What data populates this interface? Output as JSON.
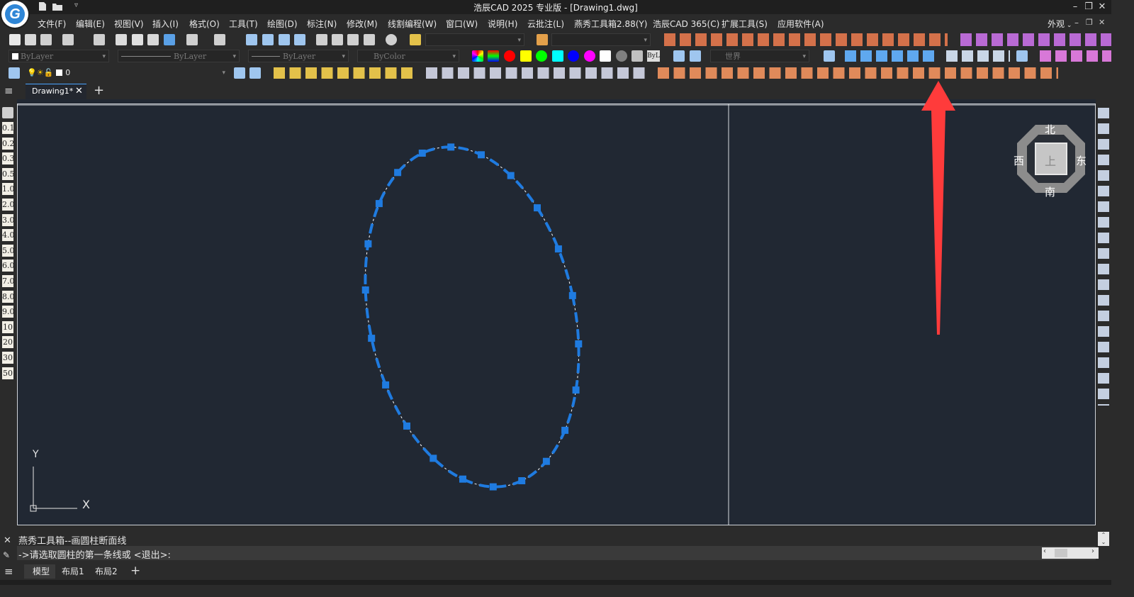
{
  "app": {
    "title": "浩辰CAD 2025 专业版 - [Drawing1.dwg]",
    "logo_letter": "G",
    "workspace": "外观"
  },
  "menu": [
    "文件(F)",
    "编辑(E)",
    "视图(V)",
    "插入(I)",
    "格式(O)",
    "工具(T)",
    "绘图(D)",
    "标注(N)",
    "修改(M)",
    "线割编程(W)",
    "窗口(W)",
    "说明(H)",
    "云批注(L)",
    "燕秀工具箱2.88(Y)",
    "浩辰CAD 365(C)",
    "扩展工具(S)",
    "应用软件(A)"
  ],
  "properties": {
    "color": "ByLayer",
    "linetype": "ByLayer",
    "lineweight": "ByLayer",
    "plotstyle": "ByColor",
    "ucs": "世界",
    "layer": "0"
  },
  "palette_colors": [
    "#ff0000",
    "#ffff00",
    "#00ff00",
    "#00ffff",
    "#0000ff",
    "#ff00ff",
    "#ffffff",
    "#808080",
    "#c0c0c0"
  ],
  "palette_end_label": "ByL",
  "tabs": {
    "drawing": "Drawing1*",
    "add": "+"
  },
  "scale_buttons": [
    "0.1",
    "0.2",
    "0.3",
    "0.5",
    "1.0",
    "2.0",
    "3.0",
    "4.0",
    "5.0",
    "6.0",
    "7.0",
    "8.0",
    "9.0",
    "10",
    "20",
    "30",
    "50"
  ],
  "viewcube": {
    "north": "北",
    "south": "南",
    "east": "东",
    "west": "西",
    "face": "上"
  },
  "ucs_icon": {
    "y_label": "Y",
    "x_label": "X"
  },
  "command": {
    "history": "燕秀工具箱--画圆柱断面线",
    "prompt": "->请选取圆柱的第一条线或 <退出>:"
  },
  "layout_tabs": [
    "模型",
    "布局1",
    "布局2"
  ],
  "colors": {
    "canvas": "#212833",
    "grip": "#1f7be0",
    "arrow": "#ff3b3b"
  }
}
